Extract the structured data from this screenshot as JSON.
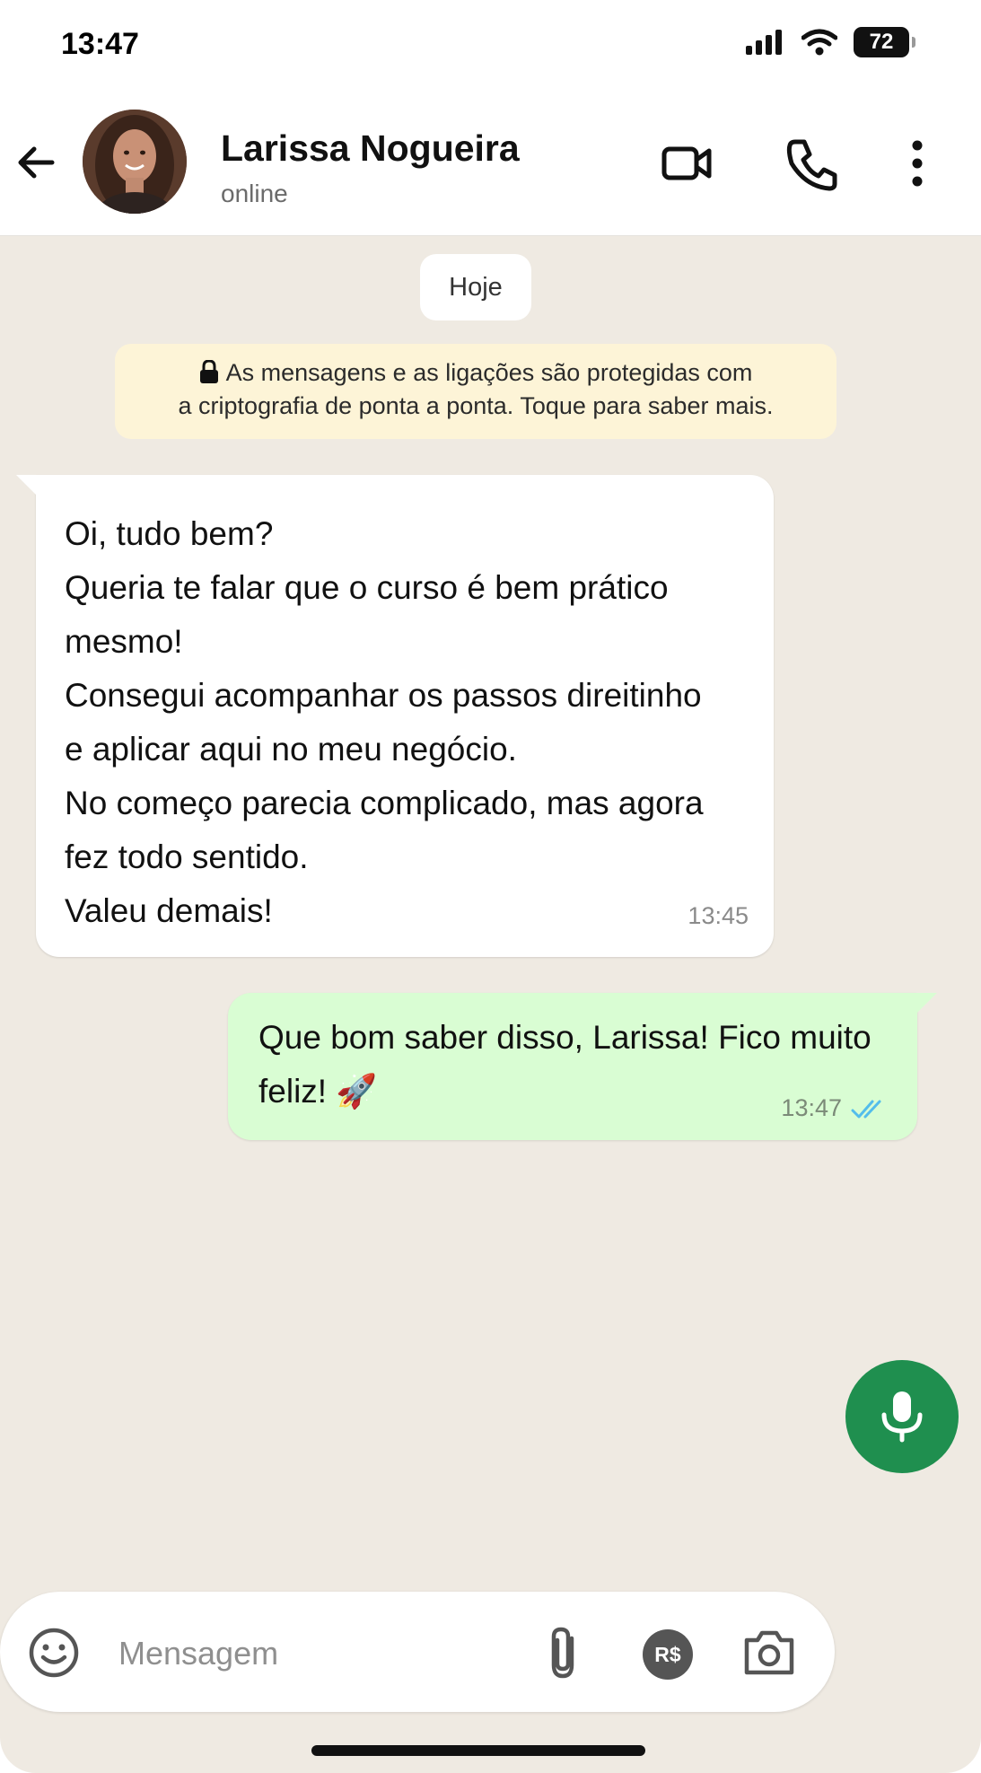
{
  "status_bar": {
    "time": "13:47",
    "battery": "72",
    "icons": [
      "signal-icon",
      "wifi-icon",
      "battery-icon"
    ]
  },
  "header": {
    "back_icon": "arrow-left-icon",
    "contact_name": "Larissa Nogueira",
    "contact_status": "online",
    "actions": [
      "video-call-icon",
      "phone-icon",
      "more-vertical-icon"
    ]
  },
  "chat": {
    "date_chip": "Hoje",
    "encryption_banner": {
      "line1": "As mensagens e as ligações são protegidas com",
      "line2": "a criptografia de ponta a ponta. Toque para saber mais."
    },
    "messages": [
      {
        "direction": "incoming",
        "text": "Oi, tudo bem?\nQueria te falar que o curso é bem prático\nmesmo!\nConsegui acompanhar os passos direitinho\ne aplicar aqui no meu negócio.\nNo começo parecia complicado, mas agora\nfez todo sentido.\nValeu demais!",
        "time": "13:45"
      },
      {
        "direction": "outgoing",
        "text_line1": "Que bom saber disso, Larissa! Fico muito",
        "text_line2": "feliz! 🚀",
        "time": "13:47",
        "read_status": "double-check-blue"
      }
    ]
  },
  "composer": {
    "placeholder": "Mensagem",
    "pay_label": "R$",
    "icons": [
      "emoji-icon",
      "paperclip-icon",
      "payment-icon",
      "camera-icon",
      "microphone-icon"
    ]
  },
  "colors": {
    "incoming_bubble": "#ffffff",
    "outgoing_bubble": "#d9fdd3",
    "chat_background": "#efeae2",
    "encryption_banner": "#fdf4d7",
    "mic_button": "#1f8f4f",
    "read_ticks": "#53bdeb"
  }
}
